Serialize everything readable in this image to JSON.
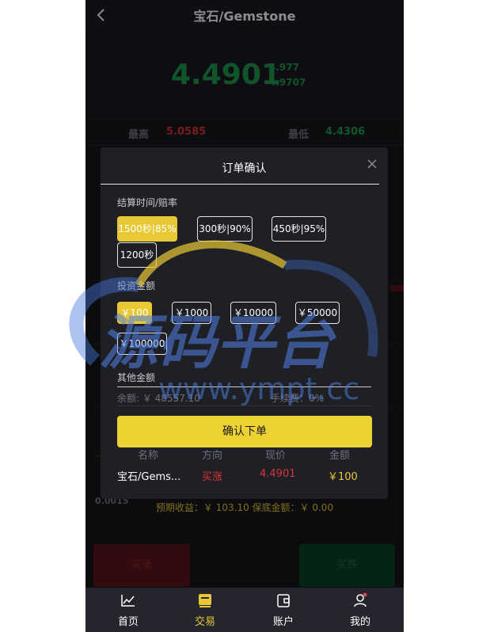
{
  "header": {
    "back_icon": "chevron-left-icon",
    "title": "宝石/Gemstone"
  },
  "ticker": {
    "price": "4.4901",
    "sub_high": "4.977",
    "sub_low": "4.9707"
  },
  "stats": {
    "high_label": "最高",
    "high_value": "5.0585",
    "low_label": "最低",
    "low_value": "4.4306"
  },
  "background": {
    "bottom_left_value": "0.0015",
    "expected_text": "预期收益：￥ 103.10    保底金额：￥ 0.00",
    "buy_button": "买涨",
    "sell_button": "买跌"
  },
  "modal": {
    "title": "订单确认",
    "close_icon": "close-icon",
    "time_label": "结算时间/赔率",
    "time_options": [
      "1500秒|85%",
      "300秒|90%",
      "450秒|95%",
      "1200秒"
    ],
    "selected_time_index": 0,
    "amount_label": "投资金额",
    "amount_options": [
      "￥100",
      "￥1000",
      "￥10000",
      "￥50000",
      "￥100000"
    ],
    "selected_amount_index": 0,
    "other_amount_label": "其他金额",
    "balance_text": "余额: ￥ 48557.10",
    "fee_text": "手续费：0%",
    "confirm_button": "确认下单",
    "info_headers": [
      "名称",
      "方向",
      "现价",
      "金额"
    ],
    "info_values": [
      "宝石/Gems...",
      "买涨",
      "4.4901",
      "￥100"
    ]
  },
  "watermark": {
    "text_cn": "源码平台",
    "text_url": "www.ympt.cc"
  },
  "tabbar": {
    "items": [
      {
        "label": "首页",
        "icon": "chart-line-icon"
      },
      {
        "label": "交易",
        "icon": "trade-card-icon"
      },
      {
        "label": "账户",
        "icon": "wallet-icon"
      },
      {
        "label": "我的",
        "icon": "user-icon"
      }
    ],
    "active_index": 1
  },
  "colors": {
    "accent": "#e9c835",
    "up": "#d9343b",
    "down": "#1f9a4f",
    "bg": "#16171c"
  }
}
